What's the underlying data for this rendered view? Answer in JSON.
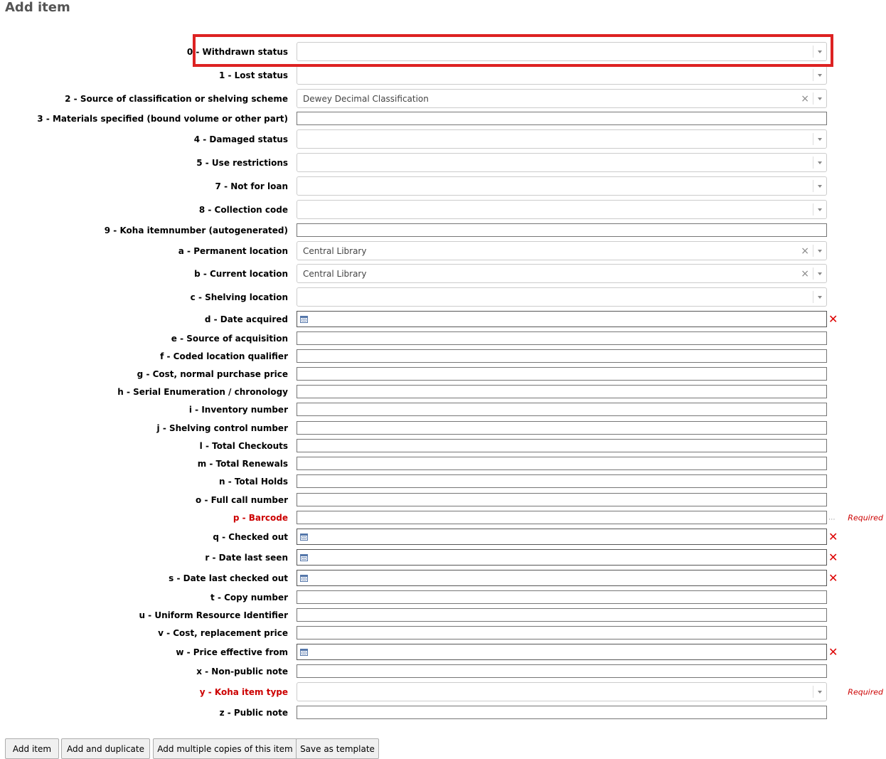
{
  "page": {
    "title": "Add item"
  },
  "fields": [
    {
      "label": "0 - Withdrawn status",
      "type": "select",
      "value": "",
      "clearable": false,
      "required": false
    },
    {
      "label": "1 - Lost status",
      "type": "select",
      "value": "",
      "clearable": false,
      "required": false
    },
    {
      "label": "2 - Source of classification or shelving scheme",
      "type": "select",
      "value": "Dewey Decimal Classification",
      "clearable": true,
      "required": false
    },
    {
      "label": "3 - Materials specified (bound volume or other part)",
      "type": "text",
      "value": "",
      "required": false
    },
    {
      "label": "4 - Damaged status",
      "type": "select",
      "value": "",
      "clearable": false,
      "required": false
    },
    {
      "label": "5 - Use restrictions",
      "type": "select",
      "value": "",
      "clearable": false,
      "required": false
    },
    {
      "label": "7 - Not for loan",
      "type": "select",
      "value": "",
      "clearable": false,
      "required": false
    },
    {
      "label": "8 - Collection code",
      "type": "select",
      "value": "",
      "clearable": false,
      "required": false
    },
    {
      "label": "9 - Koha itemnumber (autogenerated)",
      "type": "text",
      "value": "",
      "required": false
    },
    {
      "label": "a - Permanent location",
      "type": "select",
      "value": "Central Library",
      "clearable": true,
      "required": false
    },
    {
      "label": "b - Current location",
      "type": "select",
      "value": "Central Library",
      "clearable": true,
      "required": false
    },
    {
      "label": "c - Shelving location",
      "type": "select",
      "value": "",
      "clearable": false,
      "required": false
    },
    {
      "label": "d - Date acquired",
      "type": "date",
      "value": "",
      "required": false
    },
    {
      "label": "e - Source of acquisition",
      "type": "text",
      "value": "",
      "required": false
    },
    {
      "label": "f - Coded location qualifier",
      "type": "text",
      "value": "",
      "required": false
    },
    {
      "label": "g - Cost, normal purchase price",
      "type": "text",
      "value": "",
      "required": false
    },
    {
      "label": "h - Serial Enumeration / chronology",
      "type": "text",
      "value": "",
      "required": false
    },
    {
      "label": "i - Inventory number",
      "type": "text",
      "value": "",
      "required": false
    },
    {
      "label": "j - Shelving control number",
      "type": "text",
      "value": "",
      "required": false
    },
    {
      "label": "l - Total Checkouts",
      "type": "text",
      "value": "",
      "required": false
    },
    {
      "label": "m - Total Renewals",
      "type": "text",
      "value": "",
      "required": false
    },
    {
      "label": "n - Total Holds",
      "type": "text",
      "value": "",
      "required": false
    },
    {
      "label": "o - Full call number",
      "type": "text",
      "value": "",
      "required": false
    },
    {
      "label": "p - Barcode",
      "type": "text",
      "value": "",
      "required": true,
      "required_note": "Required",
      "extra": "..."
    },
    {
      "label": "q - Checked out",
      "type": "date",
      "value": "",
      "required": false
    },
    {
      "label": "r - Date last seen",
      "type": "date",
      "value": "",
      "required": false
    },
    {
      "label": "s - Date last checked out",
      "type": "date",
      "value": "",
      "required": false
    },
    {
      "label": "t - Copy number",
      "type": "text",
      "value": "",
      "required": false
    },
    {
      "label": "u - Uniform Resource Identifier",
      "type": "text",
      "value": "",
      "required": false
    },
    {
      "label": "v - Cost, replacement price",
      "type": "text",
      "value": "",
      "required": false
    },
    {
      "label": "w - Price effective from",
      "type": "date",
      "value": "",
      "required": false
    },
    {
      "label": "x - Non-public note",
      "type": "text",
      "value": "",
      "required": false
    },
    {
      "label": "y - Koha item type",
      "type": "select",
      "value": "",
      "clearable": false,
      "required": true,
      "required_note": "Required"
    },
    {
      "label": "z - Public note",
      "type": "text",
      "value": "",
      "required": false
    }
  ],
  "buttons": {
    "add_item": "Add item",
    "add_and_duplicate": "Add and duplicate",
    "add_multiple": "Add multiple copies of this item",
    "save_template": "Save as template"
  },
  "icons": {
    "date_clear": "✕",
    "select_clear": "×",
    "calendar": "calendar-icon",
    "dropdown": "chevron-down-icon"
  },
  "colors": {
    "required": "#cc0000",
    "highlight": "#dd2222",
    "clear_date": "#dd0000"
  }
}
